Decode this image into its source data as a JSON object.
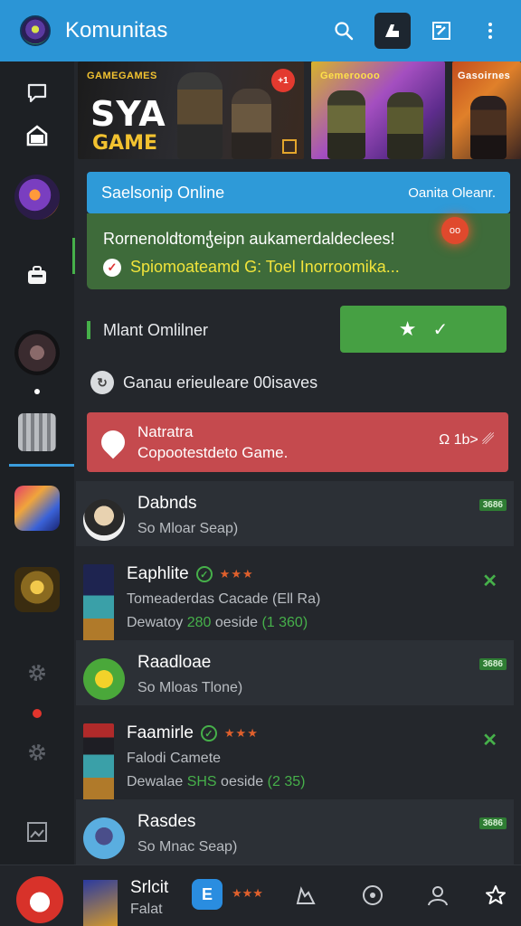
{
  "app": {
    "title": "Komunitas"
  },
  "top_actions": [
    "search-icon",
    "compose-icon",
    "edit-icon",
    "more-icon"
  ],
  "banner": {
    "badge": "GAMEGAMES",
    "title_line1": "SYA",
    "title_line2": "GAME",
    "corner_badge": "+1",
    "card2_label": "Gemeroooo",
    "card3_label": "Gasoirnes"
  },
  "online_bar": {
    "title": "Saelsonip Online",
    "right": "Oanita Oleanr."
  },
  "promo": {
    "line1": "Rornenoldtomჭeipn aukamerdaldeclees!",
    "line2": "Spiomoateamd G: Toel Inorroomika...",
    "badge": "oo"
  },
  "member": {
    "label": "Mlant Omlilner"
  },
  "notice": {
    "text": "Ganau erieuleare 00isaves"
  },
  "alert": {
    "title": "Natratra",
    "subtitle": "Copootestdeto Game.",
    "meta": "Ω 1b> ␥"
  },
  "list": [
    {
      "name": "Dabnds",
      "sub": "So Mloar Seap)",
      "tag": "3686",
      "type": "simple"
    },
    {
      "name": "Eaphlite",
      "sub": "Tomeaderdas Cacade (Ell Ra)",
      "extra_prefix": "Dewatoy ",
      "extra_hl": "280",
      "extra_mid": " oeside ",
      "extra_tail": "(1 360)",
      "type": "rich"
    },
    {
      "name": "Raadloae",
      "sub": "So Mloas Tlone)",
      "tag": "3686",
      "type": "simple"
    },
    {
      "name": "Faamirle",
      "sub": "Falodi Camete",
      "extra_prefix": "Dewalae ",
      "extra_hl": "SHS",
      "extra_mid": " oeside ",
      "extra_tail": "(2 35)",
      "type": "rich"
    },
    {
      "name": "Rasdes",
      "sub": "So Mnac Seap)",
      "tag": "3686",
      "type": "simple"
    }
  ],
  "bottom": {
    "name": "Srlcit",
    "sub": "Falat",
    "app_letter": "E"
  },
  "bottom_nav": [
    "profile-nav-icon",
    "settings-nav-icon",
    "user-nav-icon",
    "star-nav-icon"
  ],
  "colors": {
    "top_bar": "#2b95d6",
    "accent_green": "#46b04a",
    "alert_red": "#c54a4e"
  }
}
